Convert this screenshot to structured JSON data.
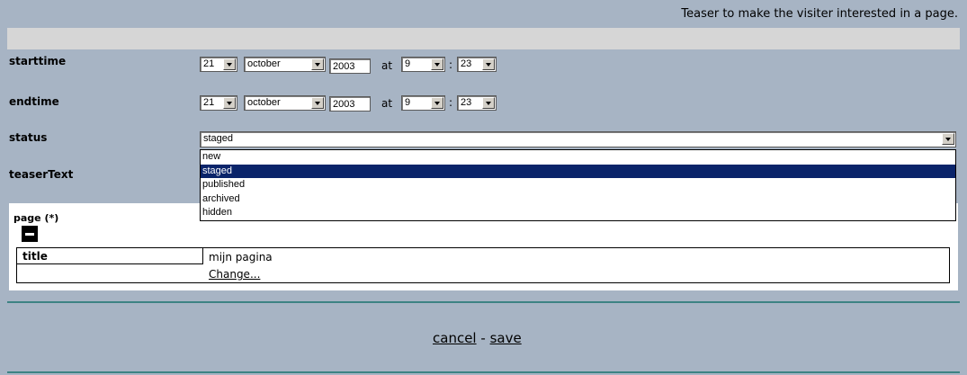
{
  "header": {
    "teaser": "Teaser to make the visiter interested in a page."
  },
  "form": {
    "starttime": {
      "label": "starttime",
      "day": "21",
      "month": "october",
      "year": "2003",
      "at": "at",
      "hour": "9",
      "sep": ":",
      "minute": "23"
    },
    "endtime": {
      "label": "endtime",
      "day": "21",
      "month": "october",
      "year": "2003",
      "at": "at",
      "hour": "9",
      "sep": ":",
      "minute": "23"
    },
    "status": {
      "label": "status",
      "value": "staged",
      "options": [
        "new",
        "staged",
        "published",
        "archived",
        "hidden"
      ]
    },
    "teaserText": {
      "label": "teaserText"
    }
  },
  "page_section": {
    "label": "page (*)",
    "title_label": "title",
    "title_value": "mijn pagina",
    "change_link": "Change..."
  },
  "actions": {
    "cancel": "cancel",
    "separator": "-",
    "save": "save"
  },
  "colors": {
    "background": "#a7b4c4",
    "selected_option": "#0a246a",
    "rule": "#3d8383"
  }
}
